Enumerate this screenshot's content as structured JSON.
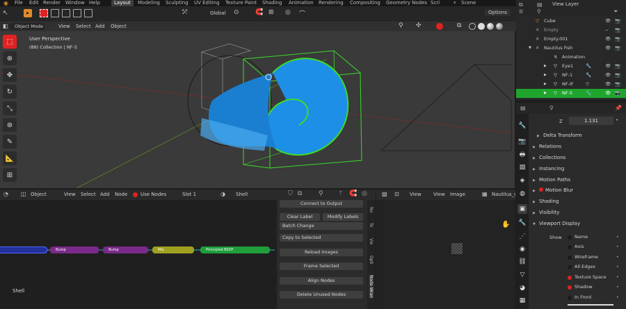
{
  "topbar": {
    "menus": [
      "File",
      "Edit",
      "Render",
      "Window",
      "Help"
    ],
    "workspaces": [
      "Layout",
      "Modeling",
      "Sculpting",
      "UV Editing",
      "Texture Paint",
      "Shading",
      "Animation",
      "Rendering",
      "Compositing",
      "Geometry Nodes",
      "Scri"
    ],
    "scene": "Scene",
    "view_layer": "View Layer"
  },
  "viewport": {
    "transform_orientation": "Global",
    "options": "Options",
    "mode": "Object Mode",
    "menus": [
      "View",
      "Select",
      "Add",
      "Object"
    ],
    "perspective": "User Perspective",
    "collection_info": "(88) Collection | NF-5"
  },
  "node_editor": {
    "editor_type": "Object",
    "menus": [
      "View",
      "Select",
      "Add",
      "Node"
    ],
    "use_nodes": "Use Nodes",
    "slot": "Slot 1",
    "material": "Shell",
    "material_label": "Shell",
    "nodes": [
      {
        "label": "Bump",
        "color": "#7a2a8a"
      },
      {
        "label": "Bump",
        "color": "#7a2a8a"
      },
      {
        "label": "Mix",
        "color": "#a0a020"
      },
      {
        "label": "Principled BSDF",
        "color": "#1f9e3a"
      }
    ],
    "panel": {
      "connect": "Connect to Output",
      "clear_label": "Clear Label",
      "modify_labels": "Modify Labels",
      "batch_change": "Batch Change",
      "copy_to_selected": "Copy to Selected",
      "reload_images": "Reload Images",
      "frame_selected": "Frame Selected",
      "align_nodes": "Align Nodes",
      "delete_unused": "Delete Unused Nodes"
    },
    "side_tabs": [
      "No",
      "To",
      "Vie",
      "Opti",
      "Node Wran"
    ]
  },
  "image_editor": {
    "menus": [
      "View",
      "View",
      "Image"
    ],
    "image_name": "Nautilus_s"
  },
  "outliner": {
    "items": [
      {
        "label": "Cube",
        "indent": 1
      },
      {
        "label": "Empty",
        "indent": 1
      },
      {
        "label": "Empty.001",
        "indent": 1
      },
      {
        "label": "Nautilus Fish",
        "indent": 1
      },
      {
        "label": "Animation",
        "indent": 2
      },
      {
        "label": "Eye1",
        "indent": 2
      },
      {
        "label": "NF-1",
        "indent": 2
      },
      {
        "label": "NF-IF",
        "indent": 2
      },
      {
        "label": "NF-5",
        "indent": 2
      }
    ],
    "selected": "NF-5"
  },
  "properties": {
    "z_label": "Z",
    "z_value": "1.131",
    "sections": [
      "Delta Transform",
      "Relations",
      "Collections",
      "Instancing",
      "Motion Paths",
      "Motion Blur",
      "Shading",
      "Visibility",
      "Viewport Display"
    ],
    "show_label": "Show",
    "show_options": [
      {
        "label": "Name",
        "on": false
      },
      {
        "label": "Axis",
        "on": false
      },
      {
        "label": "Wireframe",
        "on": false
      },
      {
        "label": "All Edges",
        "on": false
      },
      {
        "label": "Texture Space",
        "on": true
      },
      {
        "label": "Shadow",
        "on": true
      },
      {
        "label": "In Front",
        "on": false
      }
    ]
  },
  "colors": {
    "accent_red": "#e02222",
    "selection_green": "#1fa52e",
    "object_blue": "#1e8fe6",
    "outline_green": "#3cdc28"
  }
}
